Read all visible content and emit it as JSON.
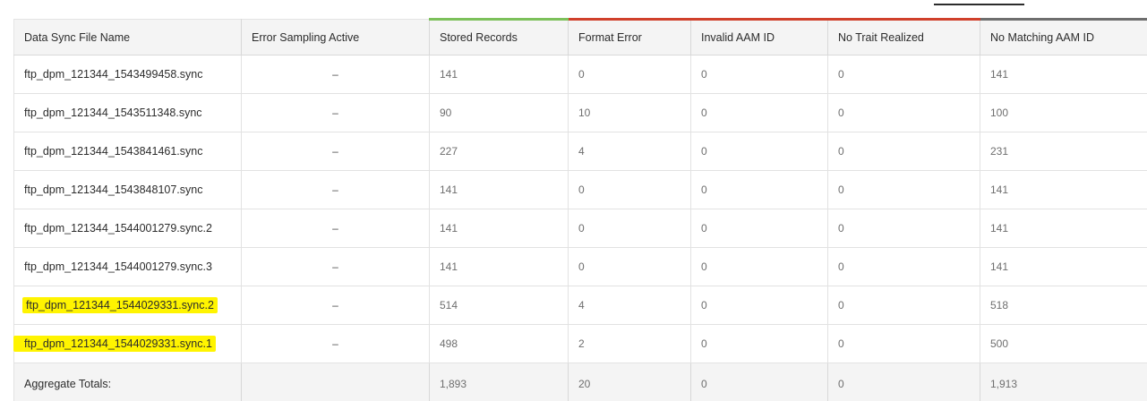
{
  "table": {
    "columns": [
      "Data Sync File Name",
      "Error Sampling Active",
      "Stored Records",
      "Format Error",
      "Invalid AAM ID",
      "No Trait Realized",
      "No Matching AAM ID"
    ],
    "column_status_colors": {
      "Stored Records": "#7cc05a",
      "Format Error": "#d0402b",
      "Invalid AAM ID": "#d0402b",
      "No Trait Realized": "#d0402b",
      "No Matching AAM ID": "#6e6e6e"
    },
    "highlight_color": "#fff400",
    "rows": [
      {
        "name": "ftp_dpm_121344_1543499458.sync",
        "sampling": "–",
        "stored": "141",
        "format_error": "0",
        "invalid_id": "0",
        "no_trait": "0",
        "no_match": "141",
        "highlighted": false
      },
      {
        "name": "ftp_dpm_121344_1543511348.sync",
        "sampling": "–",
        "stored": "90",
        "format_error": "10",
        "invalid_id": "0",
        "no_trait": "0",
        "no_match": "100",
        "highlighted": false
      },
      {
        "name": "ftp_dpm_121344_1543841461.sync",
        "sampling": "–",
        "stored": "227",
        "format_error": "4",
        "invalid_id": "0",
        "no_trait": "0",
        "no_match": "231",
        "highlighted": false
      },
      {
        "name": "ftp_dpm_121344_1543848107.sync",
        "sampling": "–",
        "stored": "141",
        "format_error": "0",
        "invalid_id": "0",
        "no_trait": "0",
        "no_match": "141",
        "highlighted": false
      },
      {
        "name": "ftp_dpm_121344_1544001279.sync.2",
        "sampling": "–",
        "stored": "141",
        "format_error": "0",
        "invalid_id": "0",
        "no_trait": "0",
        "no_match": "141",
        "highlighted": false
      },
      {
        "name": "ftp_dpm_121344_1544001279.sync.3",
        "sampling": "–",
        "stored": "141",
        "format_error": "0",
        "invalid_id": "0",
        "no_trait": "0",
        "no_match": "141",
        "highlighted": false
      },
      {
        "name": "ftp_dpm_121344_1544029331.sync.2",
        "sampling": "–",
        "stored": "514",
        "format_error": "4",
        "invalid_id": "0",
        "no_trait": "0",
        "no_match": "518",
        "highlighted": true
      },
      {
        "name": "ftp_dpm_121344_1544029331.sync.1",
        "sampling": "–",
        "stored": "498",
        "format_error": "2",
        "invalid_id": "0",
        "no_trait": "0",
        "no_match": "500",
        "highlighted": true
      }
    ],
    "totals": {
      "label": "Aggregate Totals:",
      "stored": "1,893",
      "format_error": "20",
      "invalid_id": "0",
      "no_trait": "0",
      "no_match": "1,913"
    }
  }
}
